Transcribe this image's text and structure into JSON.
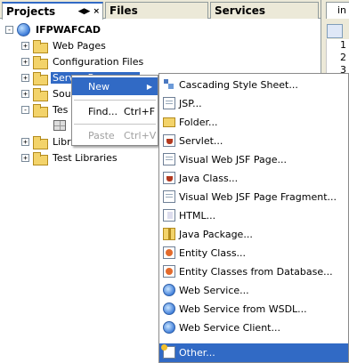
{
  "tabs": {
    "projects": "Projects",
    "files": "Files",
    "services": "Services",
    "projects_controls": [
      "◀▶",
      "×"
    ]
  },
  "editor": {
    "tab_label": "in",
    "line_numbers": [
      "1",
      "2",
      "3"
    ]
  },
  "tree": {
    "root": "IFPWAFCAD",
    "items": [
      {
        "label": "Web Pages",
        "icon": "folder-icon",
        "expander": "+"
      },
      {
        "label": "Configuration Files",
        "icon": "folder-icon",
        "expander": "+"
      },
      {
        "label": "Server Resources",
        "icon": "folder-icon",
        "expander": "+"
      },
      {
        "label": "Sou",
        "icon": "folder-icon",
        "expander": "+"
      },
      {
        "label": "Tes",
        "icon": "folder-icon",
        "expander": "-"
      },
      {
        "label": "",
        "icon": "grid-icon",
        "expander": ""
      },
      {
        "label": "Libr",
        "icon": "folder-icon",
        "expander": "+"
      },
      {
        "label": "Test Libraries",
        "icon": "folder-icon",
        "expander": "+"
      }
    ],
    "root_expander": "-"
  },
  "context_menu": {
    "new_label": "New",
    "find_label": "Find...",
    "find_shortcut": "Ctrl+F",
    "paste_label": "Paste",
    "paste_shortcut": "Ctrl+V",
    "arrow": "▶"
  },
  "submenu": {
    "items": [
      {
        "label": "Cascading Style Sheet...",
        "icon": "css-icon"
      },
      {
        "label": "JSP...",
        "icon": "jsp-page-icon"
      },
      {
        "label": "Folder...",
        "icon": "folder-icon"
      },
      {
        "label": "Servlet...",
        "icon": "servlet-icon"
      },
      {
        "label": "Visual Web JSF Page...",
        "icon": "jsf-page-icon"
      },
      {
        "label": "Java Class...",
        "icon": "java-class-icon"
      },
      {
        "label": "Visual Web JSF Page Fragment...",
        "icon": "jsf-fragment-icon"
      },
      {
        "label": "HTML...",
        "icon": "html-icon"
      },
      {
        "label": "Java Package...",
        "icon": "java-package-icon"
      },
      {
        "label": "Entity Class...",
        "icon": "entity-class-icon"
      },
      {
        "label": "Entity Classes from Database...",
        "icon": "entity-db-icon"
      },
      {
        "label": "Web Service...",
        "icon": "web-service-icon"
      },
      {
        "label": "Web Service from WSDL...",
        "icon": "wsdl-icon"
      },
      {
        "label": "Web Service Client...",
        "icon": "ws-client-icon"
      },
      {
        "label": "Other...",
        "icon": "other-icon"
      }
    ]
  },
  "colors": {
    "selection": "#316ac5",
    "chrome": "#ece9d8",
    "border": "#919b9c"
  }
}
